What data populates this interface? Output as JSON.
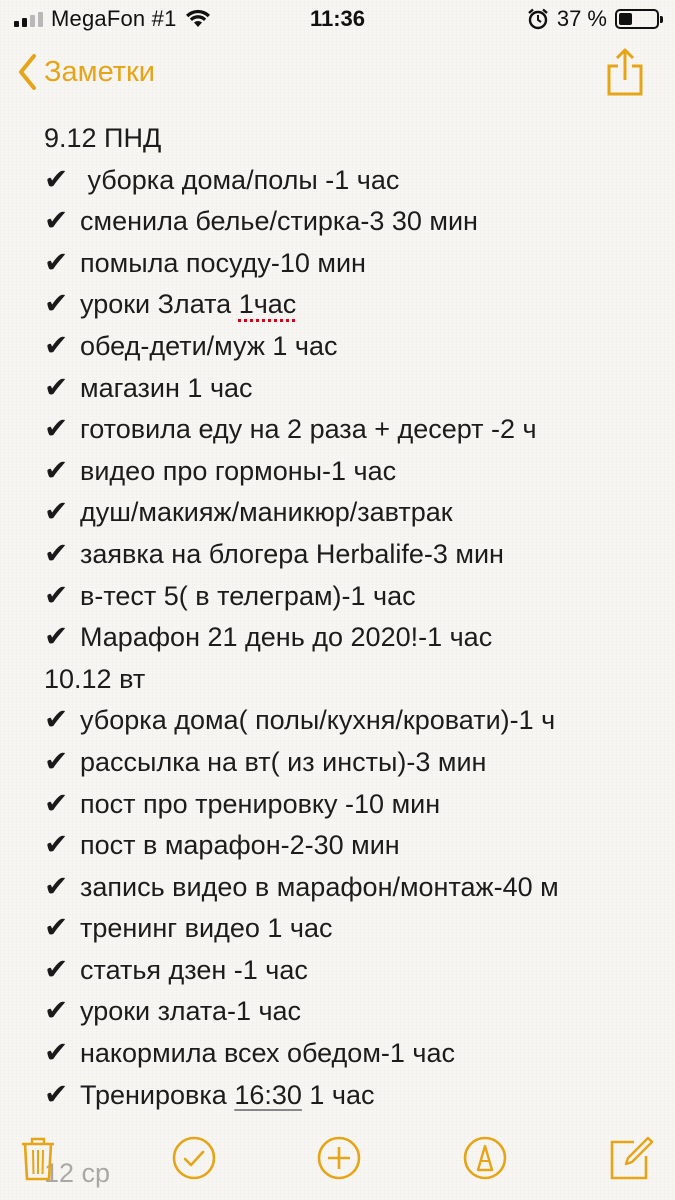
{
  "status_bar": {
    "carrier": "MegaFon #1",
    "time": "11:36",
    "battery_text": "37 %",
    "battery_level": 0.37,
    "signal_bars_filled": 2,
    "signal_bars_total": 4
  },
  "nav": {
    "back_label": "Заметки",
    "back_icon": "chevron-left-icon",
    "share_icon": "share-icon"
  },
  "colors": {
    "accent": "#e6a417",
    "background": "#f7f6f2",
    "text": "#1c1c1c"
  },
  "note": {
    "check_glyph": "✔",
    "lines": [
      {
        "type": "heading",
        "text": "9.12 ПНД"
      },
      {
        "type": "check",
        "text": " уборка дома/полы -1 час"
      },
      {
        "type": "check",
        "text": "сменила белье/стирка-3 30 мин"
      },
      {
        "type": "check",
        "text": "помыла посуду-10 мин"
      },
      {
        "type": "check",
        "text": "уроки Злата ",
        "mark": "1час",
        "mark_style": "spell-error"
      },
      {
        "type": "check",
        "text": "обед-дети/муж 1 час"
      },
      {
        "type": "check",
        "text": "магазин 1 час"
      },
      {
        "type": "check",
        "text": "готовила еду на 2 раза + десерт -2 ч"
      },
      {
        "type": "check",
        "text": "видео про гормоны-1 час"
      },
      {
        "type": "check",
        "text": "душ/макияж/маникюр/завтрак"
      },
      {
        "type": "check",
        "text": "заявка на блогера Herbalife-3 мин"
      },
      {
        "type": "check",
        "text": "в-тест 5( в телеграм)-1 час"
      },
      {
        "type": "check",
        "text": "Марафон 21 день до 2020!-1 час"
      },
      {
        "type": "heading",
        "text": "10.12 вт"
      },
      {
        "type": "check",
        "text": "уборка дома( полы/кухня/кровати)-1 ч"
      },
      {
        "type": "check",
        "text": "рассылка на вт( из инсты)-3 мин"
      },
      {
        "type": "check",
        "text": "пост про тренировку -10 мин"
      },
      {
        "type": "check",
        "text": "пост в марафон-2-30 мин"
      },
      {
        "type": "check",
        "text": "запись видео в марафон/монтаж-40 м"
      },
      {
        "type": "check",
        "text": "тренинг видео 1 час"
      },
      {
        "type": "check",
        "text": "статья дзен -1 час"
      },
      {
        "type": "check",
        "text": "уроки злата-1 час"
      },
      {
        "type": "check",
        "text": "накормила всех обедом-1 час"
      },
      {
        "type": "check",
        "text": "Тренировка ",
        "mark": "16:30",
        "mark_style": "link",
        "after": " 1 час"
      }
    ],
    "faded_bottom_text": "12 ср"
  },
  "toolbar": {
    "items": [
      {
        "name": "trash-button",
        "icon": "trash-icon"
      },
      {
        "name": "checklist-button",
        "icon": "checkmark-circle-icon"
      },
      {
        "name": "add-button",
        "icon": "plus-circle-icon"
      },
      {
        "name": "markup-button",
        "icon": "pen-circle-icon"
      },
      {
        "name": "compose-button",
        "icon": "compose-icon"
      }
    ]
  }
}
